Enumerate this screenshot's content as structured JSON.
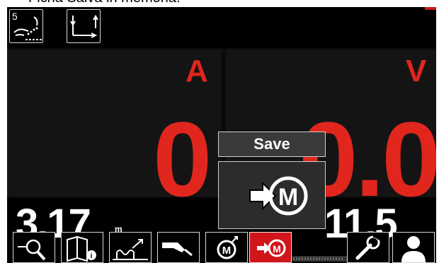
{
  "caption": "Ficha Salva in memoria.",
  "header": {
    "process_number": "5",
    "process_icon": "process-tig-hand-icon",
    "trigger_icon": "trigger-2step-icon"
  },
  "display": {
    "left_unit": "A",
    "right_unit": "V",
    "current_value": "0",
    "voltage_value": "0.0",
    "wire_speed_value": "3.17",
    "wire_speed_unit": "m",
    "trim_value": "11.5"
  },
  "dialog": {
    "title": "Save",
    "button_icon": "save-to-memory-icon"
  },
  "toolbar": {
    "items": [
      {
        "name": "search-icon"
      },
      {
        "name": "manual-info-icon"
      },
      {
        "name": "weld-settings-icon"
      },
      {
        "name": "torch-icon"
      },
      {
        "name": "recall-memory-icon"
      },
      {
        "name": "save-memory-icon",
        "active": true
      },
      {
        "name": "wrench-icon"
      },
      {
        "name": "user-icon"
      }
    ]
  },
  "colors": {
    "accent_red": "#e0261d",
    "active_button": "#d0161b",
    "background": "#141414"
  }
}
